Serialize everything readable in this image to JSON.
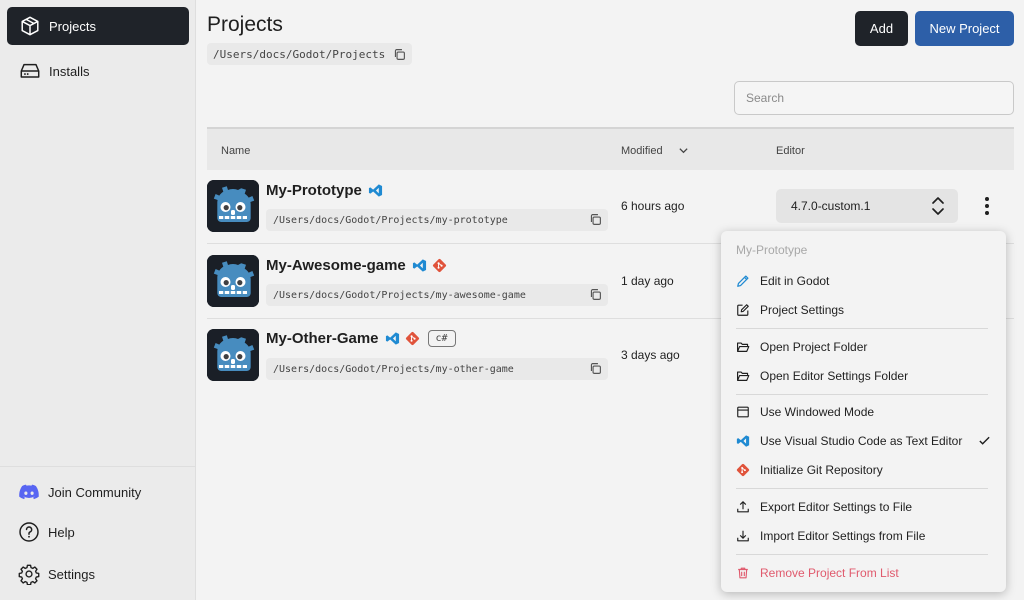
{
  "sidebar": {
    "nav": [
      {
        "label": "Projects",
        "icon": "cube-icon",
        "active": true
      },
      {
        "label": "Installs",
        "icon": "drive-icon",
        "active": false
      }
    ],
    "footer": [
      {
        "label": "Join Community",
        "icon": "discord-icon"
      },
      {
        "label": "Help",
        "icon": "help-icon"
      },
      {
        "label": "Settings",
        "icon": "gear-icon"
      }
    ]
  },
  "header": {
    "title": "Projects",
    "path": "/Users/docs/Godot/Projects",
    "add_label": "Add",
    "new_project_label": "New Project"
  },
  "search": {
    "placeholder": "Search",
    "value": ""
  },
  "table": {
    "columns": {
      "name": "Name",
      "modified": "Modified",
      "editor": "Editor"
    },
    "rows": [
      {
        "name": "My-Prototype",
        "path": "/Users/docs/Godot/Projects/my-prototype",
        "modified": "6 hours ago",
        "editor": "4.7.0-custom.1",
        "tags": [
          "vscode-icon"
        ]
      },
      {
        "name": "My-Awesome-game",
        "path": "/Users/docs/Godot/Projects/my-awesome-game",
        "modified": "1 day ago",
        "tags": [
          "vscode-icon",
          "git-icon"
        ]
      },
      {
        "name": "My-Other-Game",
        "path": "/Users/docs/Godot/Projects/my-other-game",
        "modified": "3 days ago",
        "tags": [
          "vscode-icon",
          "git-icon"
        ],
        "badge": "c#"
      }
    ]
  },
  "context_menu": {
    "title": "My-Prototype",
    "items": [
      {
        "label": "Edit in Godot",
        "icon": "pencil-icon"
      },
      {
        "label": "Project Settings",
        "icon": "edit-square-icon"
      },
      {
        "label": "Open Project Folder",
        "icon": "folder-open-icon"
      },
      {
        "label": "Open Editor Settings Folder",
        "icon": "folder-open-icon"
      },
      {
        "label": "Use Windowed Mode",
        "icon": "window-icon"
      },
      {
        "label": "Use Visual Studio Code as Text Editor",
        "icon": "vscode-icon",
        "checked": true
      },
      {
        "label": "Initialize Git Repository",
        "icon": "git-icon"
      },
      {
        "label": "Export Editor Settings to File",
        "icon": "upload-icon"
      },
      {
        "label": "Import Editor Settings from File",
        "icon": "download-icon"
      },
      {
        "label": "Remove Project From List",
        "icon": "trash-icon",
        "danger": true
      }
    ]
  },
  "colors": {
    "accent": "#2d5fa8",
    "dark": "#1f2329",
    "danger": "#e05a6d",
    "vscode": "#1f8ad2",
    "git": "#e0533b",
    "godot": "#478cbf"
  }
}
